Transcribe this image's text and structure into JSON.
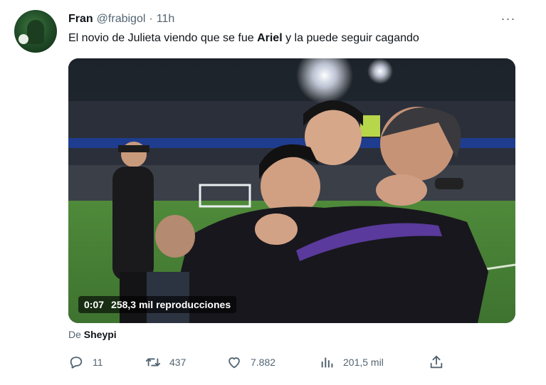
{
  "tweet": {
    "author_name": "Fran",
    "author_handle": "@frabigol",
    "separator": "·",
    "time": "11h",
    "more_label": "···",
    "text_before": "El novio de Julieta viendo que se fue ",
    "text_bold": "Ariel",
    "text_after": " y la puede seguir cagando"
  },
  "media": {
    "duration": "0:07",
    "views": "258,3 mil reproducciones"
  },
  "source": {
    "prefix": "De",
    "account": "Sheypi"
  },
  "actions": {
    "reply_count": "11",
    "retweet_count": "437",
    "like_count": "7.882",
    "views_count": "201,5 mil"
  },
  "icons": {
    "reply": "reply-icon",
    "retweet": "retweet-icon",
    "like": "heart-icon",
    "views": "views-chart-icon",
    "share": "share-icon"
  },
  "colors": {
    "text": "#0f1419",
    "secondary": "#536471",
    "background": "#ffffff"
  }
}
